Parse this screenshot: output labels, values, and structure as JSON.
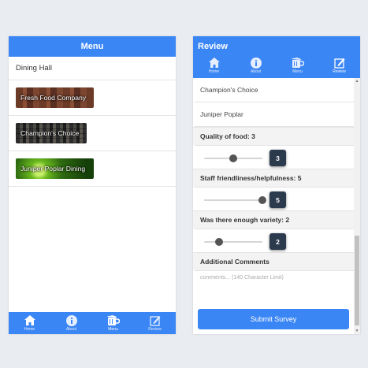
{
  "menu_screen": {
    "header_title": "Menu",
    "dining_hall_label": "Dining Hall",
    "locations": [
      {
        "name": "Fresh Food Company"
      },
      {
        "name": "Champion's Choice"
      },
      {
        "name": "Juniper Poplar Dining"
      }
    ],
    "bottom_nav": [
      {
        "label": "Home",
        "icon": "home-icon"
      },
      {
        "label": "About",
        "icon": "info-icon"
      },
      {
        "label": "Menu",
        "icon": "menu-icon",
        "active": true
      },
      {
        "label": "Review",
        "icon": "review-icon"
      }
    ]
  },
  "review_screen": {
    "header_title": "Review",
    "top_nav": [
      {
        "label": "Home",
        "icon": "home-icon"
      },
      {
        "label": "About",
        "icon": "info-icon"
      },
      {
        "label": "Menu",
        "icon": "menu-icon"
      },
      {
        "label": "Review",
        "icon": "review-icon",
        "active": true
      }
    ],
    "options": [
      "Champion's Choice",
      "Juniper Poplar"
    ],
    "questions": [
      {
        "label": "Quality of food: 3",
        "value": 3,
        "min": 1,
        "max": 5
      },
      {
        "label": "Staff friendliness/helpfulness: 5",
        "value": 5,
        "min": 1,
        "max": 5
      },
      {
        "label": "Was there enough variety: 2",
        "value": 2,
        "min": 1,
        "max": 5
      }
    ],
    "comments_label": "Additional Comments",
    "comments_placeholder": "comments... (140 Character Limit)",
    "submit_label": "Submit Survey"
  },
  "colors": {
    "primary": "#3b86f5",
    "bubble": "#2c3a4e",
    "background": "#e9ecf1"
  }
}
